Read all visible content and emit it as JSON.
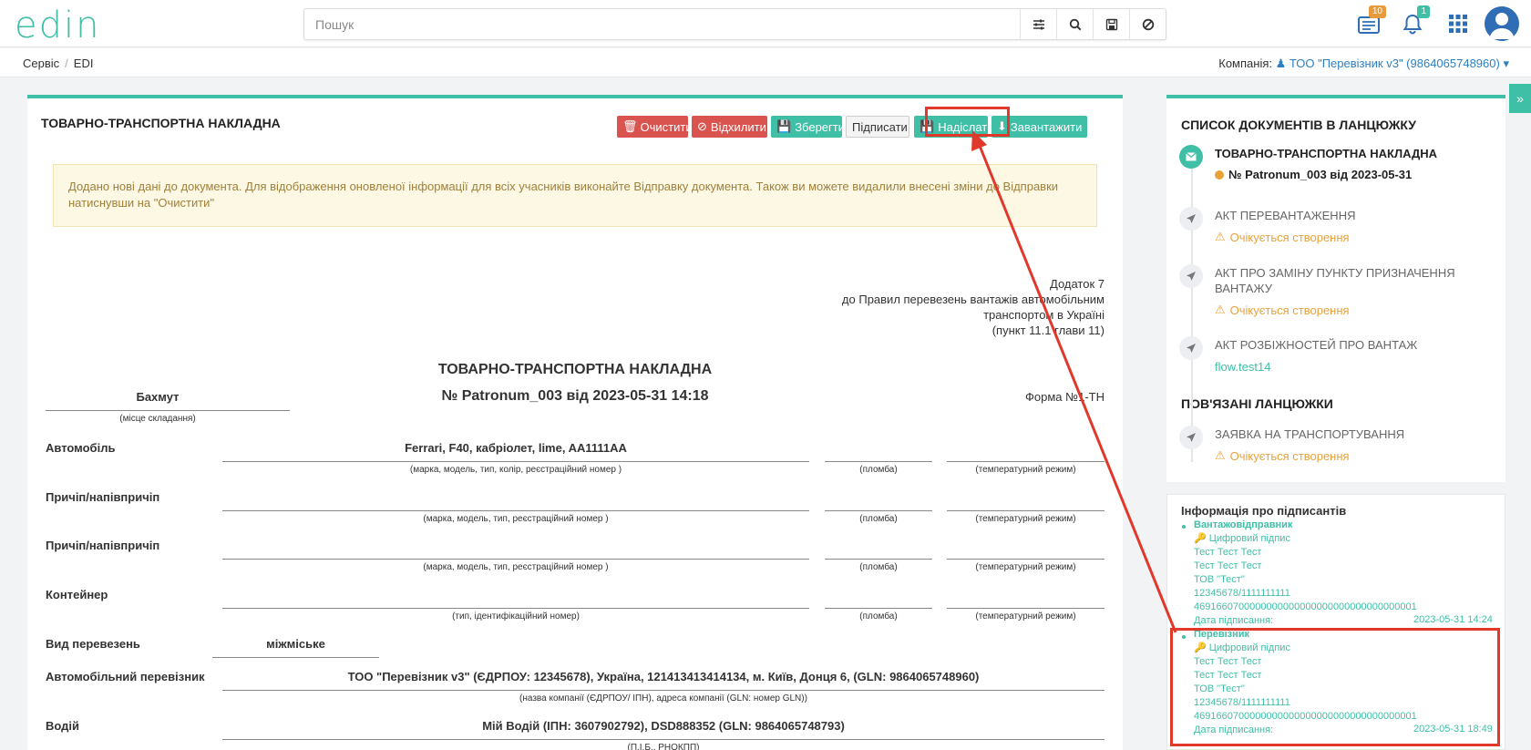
{
  "app": {
    "logo": "edin"
  },
  "search": {
    "placeholder": "Пошук"
  },
  "notifications": {
    "docs_count": "10",
    "bell_count": "1"
  },
  "breadcrumb": {
    "items": [
      "Сервіс",
      "EDI"
    ]
  },
  "company": {
    "label": "Компанія:",
    "name": "ТОО \"Перевізник v3\" (9864065748960)"
  },
  "toolbar": {
    "title": "ТОВАРНО-ТРАНСПОРТНА НАКЛАДНА",
    "clear": "Очистити",
    "reject": "Відхилити",
    "save": "Зберегти",
    "sign": "Підписати",
    "send": "Надіслати",
    "download": "Завантажити"
  },
  "alert": {
    "text": "Додано нові дані до документа. Для відображення оновленої інформації для всіх учасників виконайте Відправку документа. Також ви можете видалили внесені зміни до Відправки натиснувши на \"Очистити\""
  },
  "document": {
    "appendix_1": "Додаток 7",
    "appendix_2": "до Правил перевезень вантажів автомобільним",
    "appendix_3": "транспортом в Україні",
    "appendix_4": "(пункт 11.1 глави 11)",
    "title": "ТОВАРНО-ТРАНСПОРТНА НАКЛАДНА",
    "number": "№ Patronum_003 від 2023-05-31 14:18",
    "place": "Бахмут",
    "place_caption": "(місце складання)",
    "form": "Форма №1-ТН",
    "car_label": "Автомобіль",
    "car_value": "Ferrari, F40, кабріолет, lime, AA1111AA",
    "car_caption": "(марка, модель, тип, колір, реєстраційний номер )",
    "seal": "(пломба)",
    "temp": "(температурний режим)",
    "trailer_label": "Причіп/напівпричіп",
    "trailer_caption": "(марка, модель, тип, реєстраційний номер )",
    "container_label": "Контейнер",
    "container_caption": "(тип, ідентифікаційний номер)",
    "transport_type_label": "Вид перевезень",
    "transport_type_value": "міжміське",
    "carrier_label": "Автомобільний перевізник",
    "carrier_value": "ТОО \"Перевізник v3\" (ЄДРПОУ: 12345678), Україна, 121413413414134, м. Київ, Донця 6, (GLN: 9864065748960)",
    "carrier_caption": "(назва компанії (ЄДРПОУ/ ІПН), адреса компанії (GLN: номер GLN))",
    "driver_label": "Водій",
    "driver_value": "Мій Водій (ІПН: 3607902792), DSD888352 (GLN: 9864065748793)",
    "driver_caption": "(П.І.Б., РНОКПП)"
  },
  "chain": {
    "title": "СПИСОК ДОКУМЕНТІВ В ЛАНЦЮЖКУ",
    "items": [
      {
        "title": "ТОВАРНО-ТРАНСПОРТНА НАКЛАДНА",
        "status": "№ Patronum_003 від 2023-05-31"
      },
      {
        "title": "АКТ ПЕРЕВАНТАЖЕННЯ",
        "status": "Очікується створення"
      },
      {
        "title_1": "АКТ ПРО ЗАМІНУ ПУНКТУ ПРИЗНАЧЕННЯ",
        "title_2": "ВАНТАЖУ",
        "status": "Очікується створення"
      },
      {
        "title": "АКТ РОЗБІЖНОСТЕЙ ПРО ВАНТАЖ",
        "status": "flow.test14"
      }
    ],
    "related_title": "ПОВ'ЯЗАНІ ЛАНЦЮЖКИ",
    "related": [
      {
        "title": "ЗАЯВКА НА ТРАНСПОРТУВАННЯ",
        "status": "Очікується створення"
      }
    ]
  },
  "signers": {
    "title": "Інформація про підписантів",
    "list": [
      {
        "role": "Вантажовідправник",
        "sig": "Цифровий підпис",
        "line1": "Тест Тест Тест",
        "line2": "Тест Тест Тест",
        "org": "ТОВ \"Тест\"",
        "code": "12345678/1111111111",
        "id": "4691660700000000000000000000000000000001",
        "date_label": "Дата підписання:",
        "date": "2023-05-31 14:24"
      },
      {
        "role": "Перевізник",
        "sig": "Цифровий підпис",
        "line1": "Тест Тест Тест",
        "line2": "Тест Тест Тест",
        "org": "ТОВ \"Тест\"",
        "code": "12345678/1111111111",
        "id": "4691660700000000000000000000000000000001",
        "date_label": "Дата підписання:",
        "date": "2023-05-31 18:49"
      }
    ]
  },
  "colors": {
    "accent": "#3ebfa6",
    "danger": "#d9534f",
    "warning": "#e8a23a",
    "annotation": "#e0392b"
  }
}
